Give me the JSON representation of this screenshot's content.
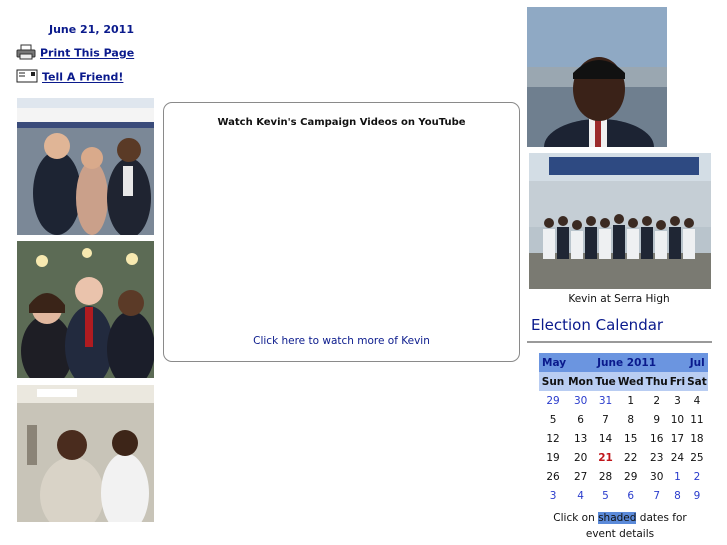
{
  "date": "June 21, 2011",
  "tools": {
    "print_label": "Print This Page",
    "tell_label": "Tell A Friend!"
  },
  "video": {
    "title": "Watch Kevin's Campaign Videos on YouTube",
    "link": "Click here to watch more of Kevin"
  },
  "right": {
    "caption": "Kevin at Serra High"
  },
  "calendar": {
    "title": "Election Calendar",
    "prev": "May",
    "month": "June 2011",
    "next": "Jul",
    "days": [
      "Sun",
      "Mon",
      "Tue",
      "Wed",
      "Thu",
      "Fri",
      "Sat"
    ],
    "weeks": [
      [
        {
          "n": "29",
          "k": "o"
        },
        {
          "n": "30",
          "k": "o"
        },
        {
          "n": "31",
          "k": "o"
        },
        {
          "n": "1",
          "k": "d"
        },
        {
          "n": "2",
          "k": "d"
        },
        {
          "n": "3",
          "k": "d"
        },
        {
          "n": "4",
          "k": "d"
        }
      ],
      [
        {
          "n": "5",
          "k": "d"
        },
        {
          "n": "6",
          "k": "d"
        },
        {
          "n": "7",
          "k": "d"
        },
        {
          "n": "8",
          "k": "d"
        },
        {
          "n": "9",
          "k": "d"
        },
        {
          "n": "10",
          "k": "d"
        },
        {
          "n": "11",
          "k": "d"
        }
      ],
      [
        {
          "n": "12",
          "k": "d"
        },
        {
          "n": "13",
          "k": "d"
        },
        {
          "n": "14",
          "k": "d"
        },
        {
          "n": "15",
          "k": "d"
        },
        {
          "n": "16",
          "k": "d"
        },
        {
          "n": "17",
          "k": "d"
        },
        {
          "n": "18",
          "k": "d"
        }
      ],
      [
        {
          "n": "19",
          "k": "d"
        },
        {
          "n": "20",
          "k": "d"
        },
        {
          "n": "21",
          "k": "t"
        },
        {
          "n": "22",
          "k": "d"
        },
        {
          "n": "23",
          "k": "d"
        },
        {
          "n": "24",
          "k": "d"
        },
        {
          "n": "25",
          "k": "d"
        }
      ],
      [
        {
          "n": "26",
          "k": "d"
        },
        {
          "n": "27",
          "k": "d"
        },
        {
          "n": "28",
          "k": "d"
        },
        {
          "n": "29",
          "k": "d"
        },
        {
          "n": "30",
          "k": "d"
        },
        {
          "n": "1",
          "k": "o"
        },
        {
          "n": "2",
          "k": "o"
        }
      ],
      [
        {
          "n": "3",
          "k": "o"
        },
        {
          "n": "4",
          "k": "o"
        },
        {
          "n": "5",
          "k": "o"
        },
        {
          "n": "6",
          "k": "o"
        },
        {
          "n": "7",
          "k": "o"
        },
        {
          "n": "8",
          "k": "o"
        },
        {
          "n": "9",
          "k": "o"
        }
      ]
    ],
    "note_pre": "Click on",
    "note_shaded": "shaded",
    "note_post": "dates for event details"
  },
  "colors": {
    "link": "#0a1a8c",
    "header": "#6b95e0",
    "today": "#c0151a"
  }
}
